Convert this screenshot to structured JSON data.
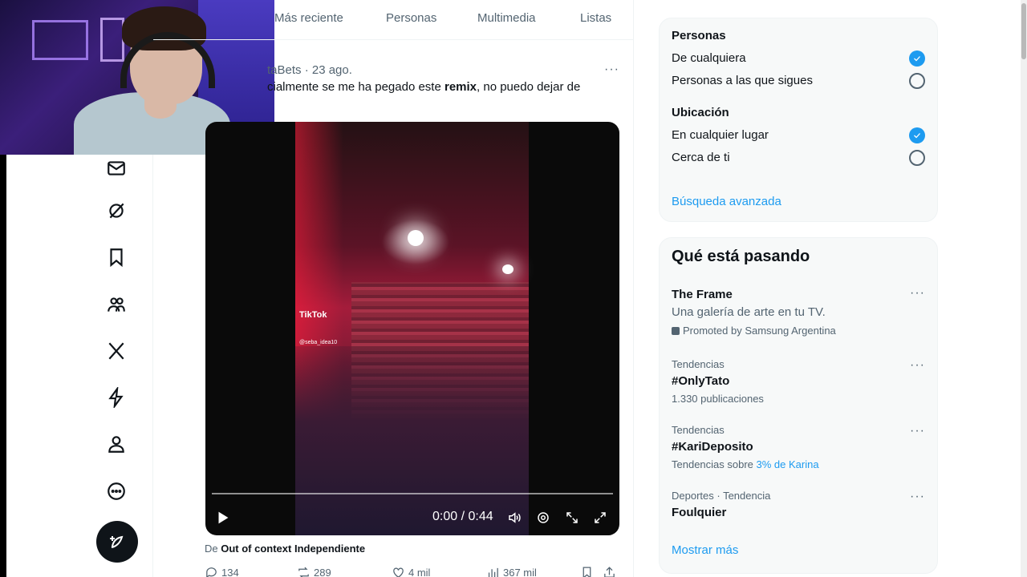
{
  "tabs": [
    "Más reciente",
    "Personas",
    "Multimedia",
    "Listas"
  ],
  "tweet": {
    "author_partial": "taBets",
    "date": "· 23 ago.",
    "more": "···",
    "text_before": "cialmente se me ha pegado este ",
    "text_bold": "remix",
    "text_after": ", no puedo dejar de",
    "video": {
      "watermark": "TikTok",
      "watermark_handle": "@seba_idea10",
      "time": "0:00 / 0:44"
    },
    "source_prefix": "De ",
    "source_name": "Out of context Independiente",
    "stats": {
      "replies": "134",
      "reposts": "289",
      "likes": "4 mil",
      "views": "367 mil"
    }
  },
  "search_filters": {
    "people_heading": "Personas",
    "people_options": [
      "De cualquiera",
      "Personas a las que sigues"
    ],
    "location_heading": "Ubicación",
    "location_options": [
      "En cualquier lugar",
      "Cerca de ti"
    ],
    "advanced_link": "Búsqueda avanzada"
  },
  "trends": {
    "title": "Qué está pasando",
    "items": [
      {
        "name": "The Frame",
        "sub": "Una galería de arte en tu TV.",
        "promo": "Promoted by Samsung Argentina"
      },
      {
        "context": "Tendencias",
        "name": "#OnlyTato",
        "count": "1.330 publicaciones"
      },
      {
        "context": "Tendencias",
        "name": "#KariDeposito",
        "sub_prefix": "Tendencias sobre ",
        "sub_link": "3% de Karina"
      },
      {
        "context": "Deportes · Tendencia",
        "name": "Foulquier"
      }
    ],
    "show_more": "Mostrar más"
  },
  "colors": {
    "accent": "#1d9bf0",
    "text": "#0f1419",
    "muted": "#536471"
  }
}
